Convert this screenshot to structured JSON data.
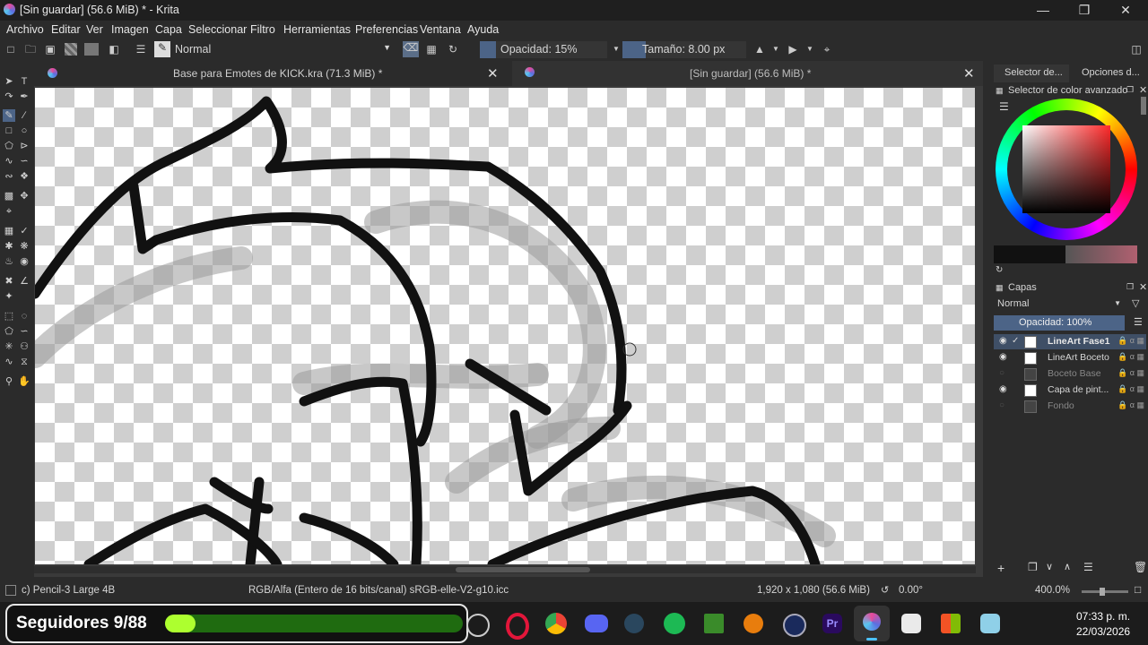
{
  "window": {
    "title": "[Sin guardar]  (56.6 MiB) * - Krita"
  },
  "menu": [
    "Archivo",
    "Editar",
    "Ver",
    "Imagen",
    "Capa",
    "Seleccionar",
    "Filtro",
    "Herramientas",
    "Preferencias",
    "Ventana",
    "Ayuda"
  ],
  "toolbar": {
    "blend_mode": "Normal",
    "opacity": "Opacidad: 15%",
    "size": "Tamaño: 8.00 px"
  },
  "tabs": [
    {
      "label": "Base para Emotes de KICK.kra (71.3 MiB) *"
    },
    {
      "label": "[Sin guardar]  (56.6 MiB) *"
    }
  ],
  "docker": {
    "tab1": "Selector de...",
    "tab2": "Opciones d...",
    "color_panel_title": "Selector de color avanzado",
    "layers_title": "Capas",
    "layers_blend": "Normal",
    "layers_opacity": "Opacidad:  100%",
    "layers": [
      {
        "name": "LineArt Fase1",
        "visible": true,
        "active": true
      },
      {
        "name": "LineArt Boceto",
        "visible": true
      },
      {
        "name": "Boceto Base",
        "visible": false
      },
      {
        "name": "Capa de pint...",
        "visible": true
      },
      {
        "name": "Fondo",
        "visible": false
      }
    ]
  },
  "status": {
    "brush": "c) Pencil-3 Large 4B",
    "color_space": "RGB/Alfa (Entero de 16 bits/canal)  sRGB-elle-V2-g10.icc",
    "dimensions": "1,920 x 1,080 (56.6 MiB)",
    "rotation": "0.00°",
    "zoom": "400.0%"
  },
  "overlay": {
    "followers": "Seguidores 9/88",
    "progress": 0.102
  },
  "taskbar": {
    "time": "07:33 p. m.",
    "date": "22/03/2026"
  }
}
